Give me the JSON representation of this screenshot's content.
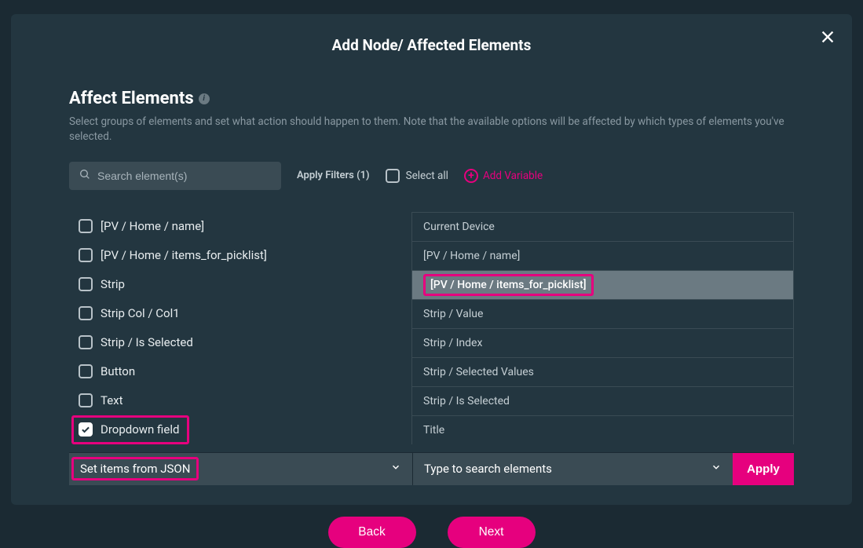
{
  "modal": {
    "title": "Add Node/ Affected Elements",
    "section_title": "Affect Elements",
    "section_desc": "Select groups of elements and set what action should happen to them. Note that the available options will be affected by which types of elements you've selected.",
    "search_placeholder": "Search element(s)",
    "apply_filters": "Apply Filters (1)",
    "select_all": "Select all",
    "add_variable": "Add Variable"
  },
  "left_items": [
    {
      "label": "[PV / Home / name]",
      "checked": false,
      "highlight": false
    },
    {
      "label": "[PV / Home / items_for_picklist]",
      "checked": false,
      "highlight": false
    },
    {
      "label": "Strip",
      "checked": false,
      "highlight": false
    },
    {
      "label": "Strip Col / Col1",
      "checked": false,
      "highlight": false
    },
    {
      "label": "Strip / Is Selected",
      "checked": false,
      "highlight": false
    },
    {
      "label": "Button",
      "checked": false,
      "highlight": false
    },
    {
      "label": "Text",
      "checked": false,
      "highlight": false
    },
    {
      "label": "Dropdown field",
      "checked": true,
      "highlight": true
    }
  ],
  "right_items": [
    {
      "label": "Current Device",
      "selected": false,
      "highlight": false
    },
    {
      "label": "[PV / Home / name]",
      "selected": false,
      "highlight": false
    },
    {
      "label": "[PV / Home / items_for_picklist]",
      "selected": true,
      "highlight": true
    },
    {
      "label": "Strip / Value",
      "selected": false,
      "highlight": false
    },
    {
      "label": "Strip / Index",
      "selected": false,
      "highlight": false
    },
    {
      "label": "Strip / Selected Values",
      "selected": false,
      "highlight": false
    },
    {
      "label": "Strip / Is Selected",
      "selected": false,
      "highlight": false
    },
    {
      "label": "Title",
      "selected": false,
      "highlight": false
    }
  ],
  "action": {
    "dropdown_value": "Set items from JSON",
    "search_placeholder": "Type to search elements",
    "apply": "Apply"
  },
  "footer": {
    "back": "Back",
    "next": "Next"
  },
  "colors": {
    "accent": "#e6007e",
    "bg": "#233640",
    "panel": "#3a4b54"
  }
}
